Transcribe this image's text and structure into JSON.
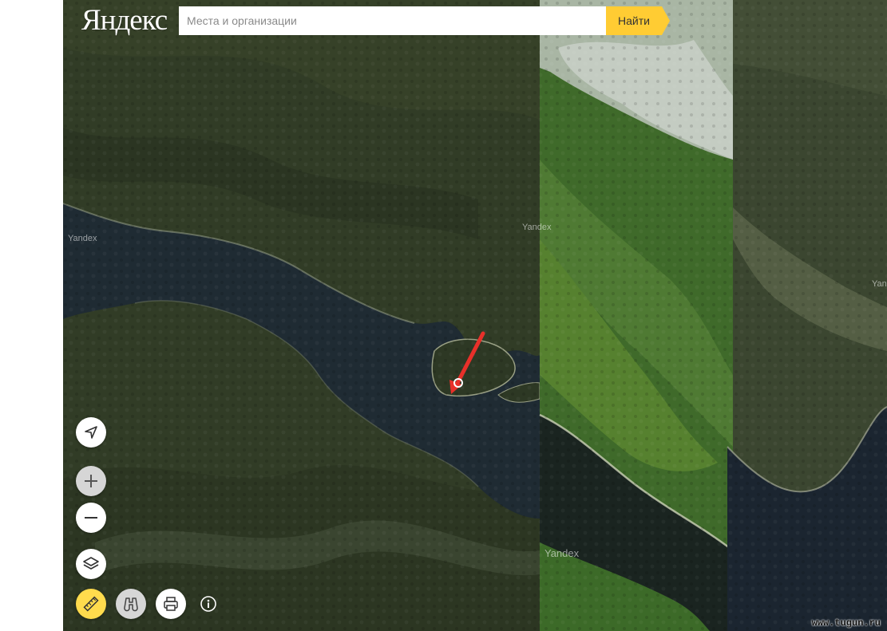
{
  "header": {
    "logo": "Яндекс",
    "search_placeholder": "Места и организации",
    "find_label": "Найти"
  },
  "map": {
    "watermarks": [
      "Yandex",
      "Yandex",
      "Yandex",
      "Yandex"
    ],
    "marker": "red-arrow-pointer"
  },
  "controls": {
    "geolocation": "navigation-arrow-icon",
    "zoom_in": "plus-icon",
    "zoom_out": "minus-icon",
    "layers": "layers-icon",
    "ruler": "ruler-icon",
    "panorama": "binoculars-icon",
    "print": "printer-icon",
    "info": "info-icon"
  },
  "footer": {
    "site": "www.tugun.ru"
  },
  "colors": {
    "search_button": "#ffcc33",
    "ruler_button": "#ffdb4d",
    "water": "#1d2a33",
    "forest": "#2f3a25"
  }
}
